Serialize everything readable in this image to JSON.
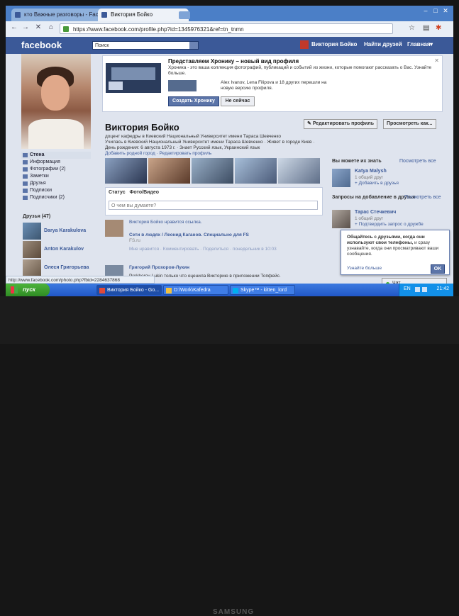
{
  "browser": {
    "tabs": [
      {
        "label": "кто Важные разговоры - Facebook",
        "active": false
      },
      {
        "label": "Виктория Бойко",
        "active": true
      }
    ],
    "url": "https://www.facebook.com/profile.php?id=1345976321&ref=tn_tnmn",
    "nav_icons": [
      "back-icon",
      "forward-icon",
      "reload-icon",
      "home-icon"
    ],
    "toolbar_icons": [
      "star-icon",
      "page-icon",
      "wrench-icon"
    ]
  },
  "facebook": {
    "logo": "facebook",
    "search_placeholder": "Поиск",
    "nav": {
      "user": "Виктория Бойко",
      "find_friends": "Найти друзей",
      "home": "Главная"
    }
  },
  "timeline_banner": {
    "title": "Представляем Хронику – новый вид профиля",
    "description": "Хроника - это ваша коллекция фотографий, публикаций и событий из жизни, которые помогают рассказать о Вас. Узнайте больше.",
    "friends_text": "Alex Ivanov, Lena Filipova и 18 других перешли на новую версию профиля.",
    "create_button": "Создать Хронику",
    "not_now_button": "Не сейчас"
  },
  "profile": {
    "name": "Виктория Бойко",
    "edit_button": "Редактировать профиль",
    "view_as_button": "Просмотреть как...",
    "info_lines": [
      "доцент кафедры в Киевский Национальный Университет имени Тараса Шевченко",
      "Училась в Киевский Национальный Университет имени Тараса Шевченко · Живет в городе Киев · День рождения: 6 августа 1973 г. · Знает Русский язык, Украинский язык",
      "Добавить родной город · Редактировать профиль"
    ]
  },
  "left_nav": {
    "items": [
      "Стена",
      "Информация",
      "Фотографии (2)",
      "Заметки",
      "Друзья",
      "Подписки",
      "Подписчики (2)"
    ],
    "friends_header": "Друзья (47)",
    "friends": [
      "Darya Karakulova",
      "Anton Karakulov",
      "Олеся Григорьева"
    ]
  },
  "composer": {
    "tabs": [
      "Статус",
      "Фото/Видео"
    ],
    "placeholder": "О чем вы думаете?"
  },
  "feed": [
    {
      "header": "Виктория Бойко нравится ссылка.",
      "title": "Сети в людях / Леонид Каганов. Специально для FS",
      "source": "FS.ru",
      "meta": "Мне нравится · Комментировать · Поделиться · понедельник в 10:03"
    },
    {
      "header": "Григорий Прохоров-Лукин",
      "title": "Prokhorov-Lukin только что оценила Викторию в приложении Топфейс."
    }
  ],
  "right_col": {
    "people_header": "Вы можете их знать",
    "people_see_all": "Посмотреть все",
    "person": {
      "name": "Katya Malysh",
      "sub": "1 общий друг",
      "action": "Добавить в друзья"
    },
    "requests_header": "Запросы на добавление в друзья",
    "requests_see_all": "Посмотреть все",
    "request": {
      "name": "Тарас Стечкевич",
      "sub": "1 общий друг",
      "action": "Подтвердить запрос о дружбе"
    }
  },
  "popup": {
    "text_bold": "Общайтесь с друзьями, когда они используют свои телефоны,",
    "text": "и сразу узнавайте, когда они просматривают ваши сообщения.",
    "more": "Узнайте больше",
    "ok": "OK"
  },
  "chat": {
    "label": "Чат"
  },
  "status_url": "http://www.facebook.com/photo.php?fbid=2284637868",
  "taskbar": {
    "start": "пуск",
    "tasks": [
      "Виктория Бойко - Go...",
      "D:\\Work\\Kafedra",
      "Skype™ - kitten_lord"
    ],
    "lang": "EN",
    "clock": "21:42"
  },
  "monitor_brand": "SAMSUNG"
}
